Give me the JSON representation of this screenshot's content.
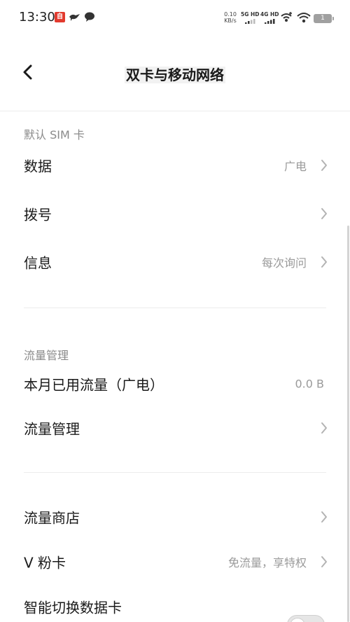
{
  "status_bar": {
    "time": "13:30",
    "app_icon_text": "自",
    "speed_value": "0.10",
    "speed_unit": "KB/s",
    "sim1_label": "5G HD",
    "sim2_label": "4G HD",
    "battery": "1"
  },
  "header": {
    "title": "双卡与移动网络",
    "back_icon": "chevron-left-icon"
  },
  "sections": {
    "default_sim": {
      "title": "默认 SIM 卡",
      "rows": [
        {
          "label": "数据",
          "value": "广电"
        },
        {
          "label": "拨号",
          "value": ""
        },
        {
          "label": "信息",
          "value": "每次询问"
        }
      ]
    },
    "traffic": {
      "title": "流量管理",
      "rows": [
        {
          "label": "本月已用流量（广电）",
          "value": "0.0 B"
        },
        {
          "label": "流量管理",
          "value": ""
        }
      ]
    },
    "more": {
      "rows": [
        {
          "label": "流量商店",
          "value": ""
        },
        {
          "label": "V 粉卡",
          "value": "免流量，享特权"
        },
        {
          "label": "智能切换数据卡",
          "value": ""
        }
      ]
    }
  },
  "colors": {
    "text_primary": "#1a1a1a",
    "text_secondary": "#9a9a9a",
    "section_header": "#8a8a8a",
    "divider": "#ececec"
  }
}
